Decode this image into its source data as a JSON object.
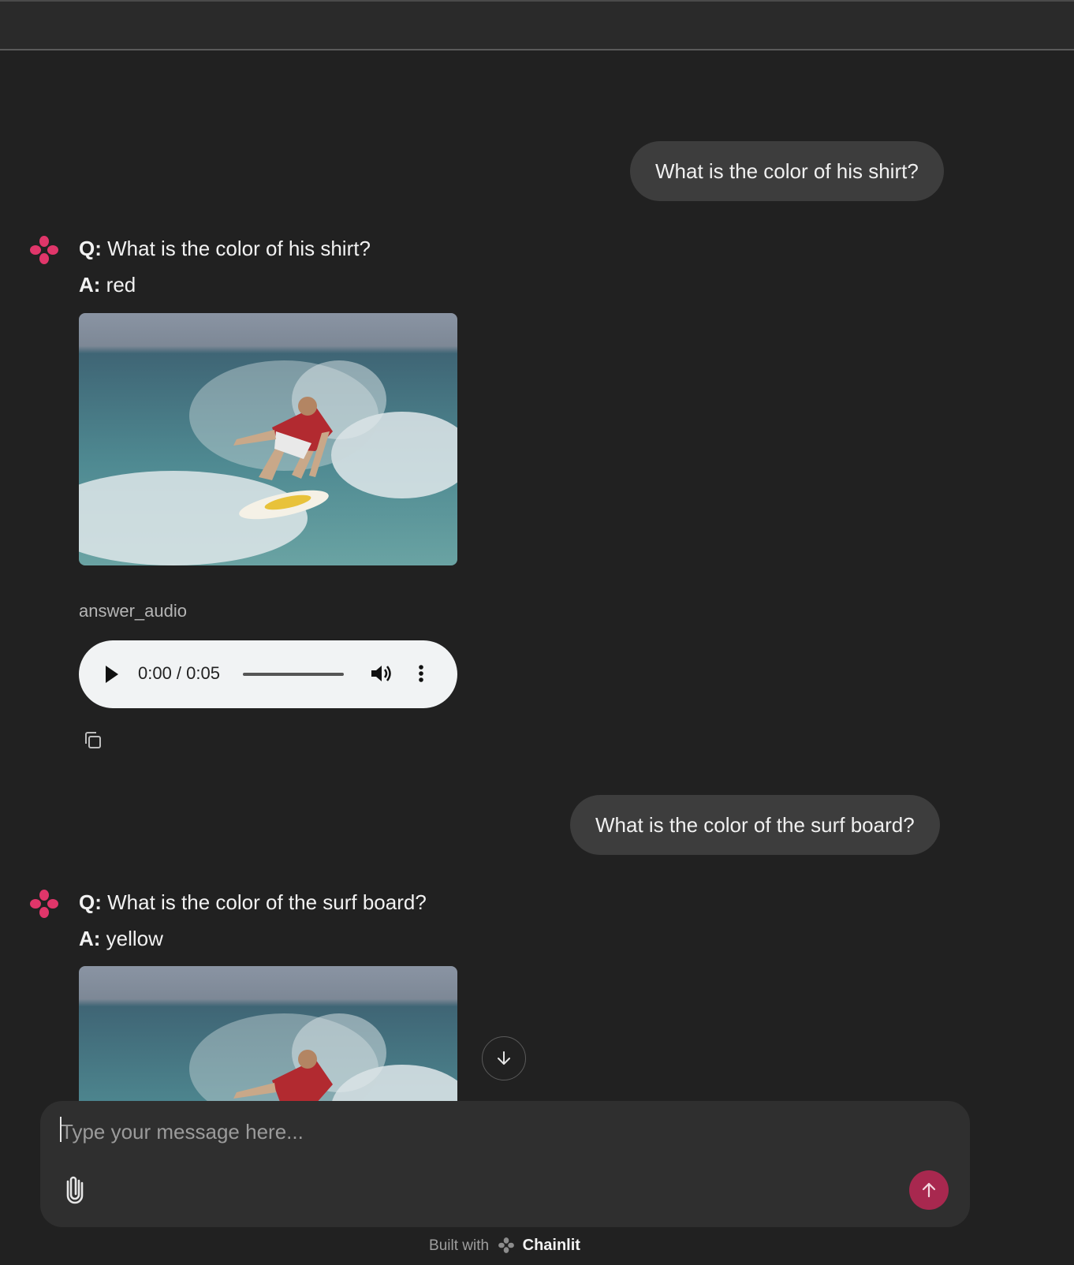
{
  "colors": {
    "accent": "#e0366a",
    "send_button": "#a8284f",
    "background": "#212121"
  },
  "messages": [
    {
      "role": "user",
      "text": "What is the color of his shirt?"
    },
    {
      "role": "assistant",
      "q_label": "Q:",
      "question": "What is the color of his shirt?",
      "a_label": "A:",
      "answer": "red",
      "image": "surfer-photo",
      "audio_element_name": "answer_audio",
      "audio_time": "0:00 / 0:05"
    },
    {
      "role": "user",
      "text": "What is the color of the surf board?"
    },
    {
      "role": "assistant",
      "q_label": "Q:",
      "question": "What is the color of the surf board?",
      "a_label": "A:",
      "answer": "yellow",
      "image": "surfer-photo"
    }
  ],
  "composer": {
    "placeholder": "Type your message here...",
    "attach_icon": "paperclip-icon",
    "send_icon": "arrow-up-icon"
  },
  "scroll_button_icon": "arrow-down-icon",
  "footer": {
    "prefix": "Built with",
    "brand": "Chainlit"
  }
}
